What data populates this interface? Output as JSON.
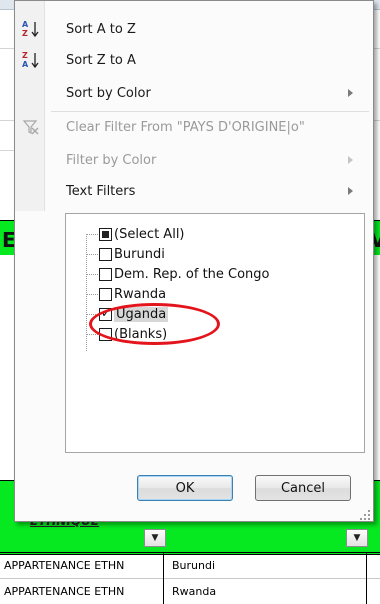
{
  "menu": {
    "sort_az": "Sort A to Z",
    "sort_za": "Sort Z to A",
    "sort_by_color": "Sort by Color",
    "clear_filter": "Clear Filter From \"PAYS D'ORIGINE|o\"",
    "filter_by_color": "Filter by Color",
    "text_filters": "Text Filters"
  },
  "checklist": {
    "items": [
      {
        "label": "(Select All)",
        "state": "indeterminate"
      },
      {
        "label": "Burundi",
        "state": "unchecked"
      },
      {
        "label": "Dem. Rep. of the Congo",
        "state": "unchecked"
      },
      {
        "label": "Rwanda",
        "state": "unchecked"
      },
      {
        "label": "Uganda",
        "state": "checked"
      },
      {
        "label": "(Blanks)",
        "state": "unchecked"
      }
    ]
  },
  "buttons": {
    "ok": "OK",
    "cancel": "Cancel"
  },
  "background": {
    "header_text": "ETHNIQUE",
    "rows": [
      {
        "col_a": "APPARTENANCE ETHN",
        "col_b": "Burundi"
      },
      {
        "col_a": "APPARTENANCE ETHN",
        "col_b": "Rwanda"
      }
    ],
    "letter_left": "E",
    "letter_right": "V"
  },
  "colors": {
    "header_green": "#06e81f",
    "annotation_red": "#e3141c"
  }
}
